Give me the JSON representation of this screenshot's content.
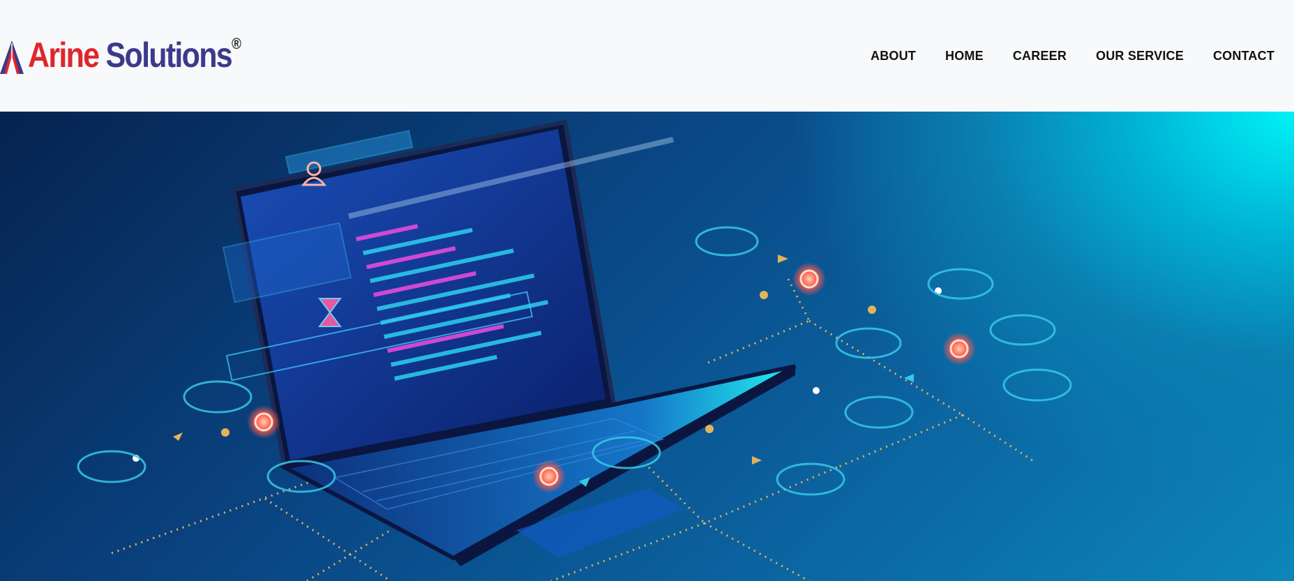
{
  "brand": {
    "word1": "Arine",
    "word2": "Solutions",
    "registered": "®",
    "colors": {
      "primary": "#e0262c",
      "secondary": "#3b3a8c"
    }
  },
  "nav": {
    "items": [
      {
        "label": "ABOUT"
      },
      {
        "label": "HOME"
      },
      {
        "label": "CAREER"
      },
      {
        "label": "OUR SERVICE"
      },
      {
        "label": "CONTACT"
      }
    ]
  },
  "hero": {
    "illustration": "laptop-network-illustration",
    "colors": {
      "dark": "#06234f",
      "accent": "#00f2f5",
      "node": "#ff5a4f",
      "line": "#e3b35c"
    }
  }
}
